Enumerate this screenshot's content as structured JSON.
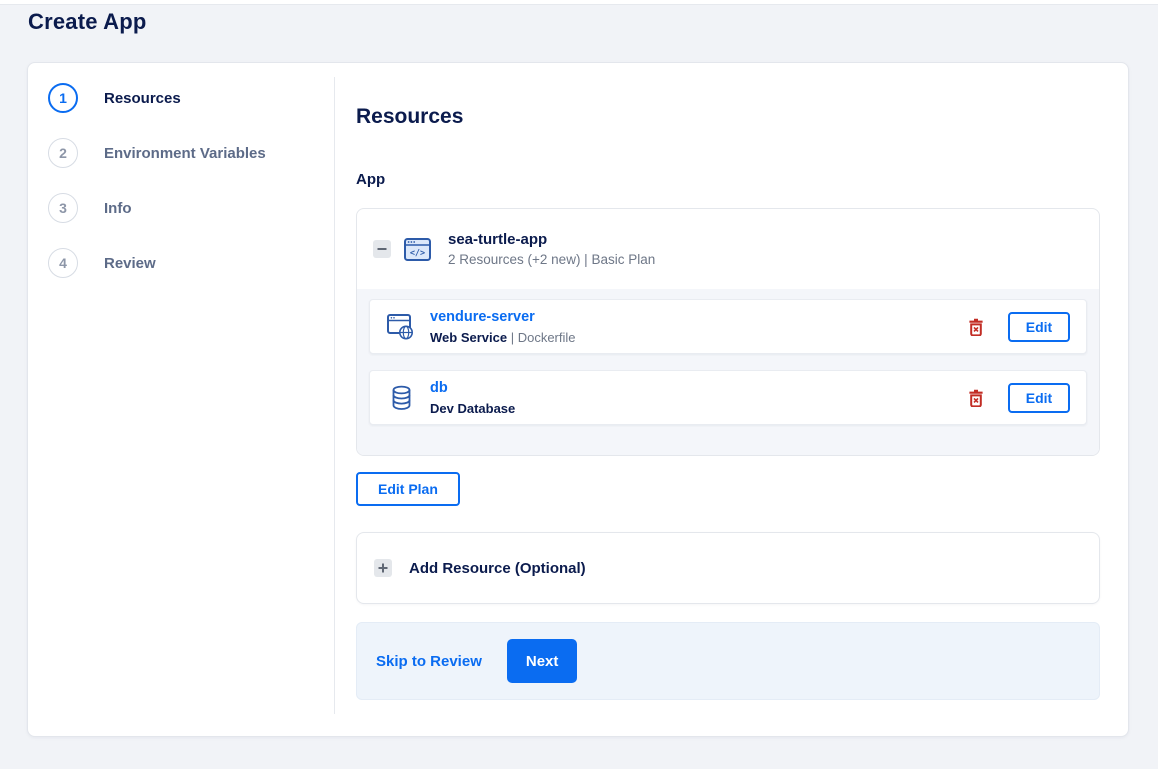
{
  "page_title": "Create App",
  "steps": [
    {
      "number": "1",
      "label": "Resources",
      "active": true
    },
    {
      "number": "2",
      "label": "Environment Variables",
      "active": false
    },
    {
      "number": "3",
      "label": "Info",
      "active": false
    },
    {
      "number": "4",
      "label": "Review",
      "active": false
    }
  ],
  "content": {
    "heading": "Resources",
    "section_label": "App",
    "app_group": {
      "name": "sea-turtle-app",
      "summary": "2 Resources (+2 new) | Basic Plan",
      "collapse_icon": "minus-icon",
      "app_icon": "code-window-icon",
      "resources": [
        {
          "name": "vendure-server",
          "type": "Web Service",
          "sep": " | ",
          "detail": "Dockerfile",
          "icon": "web-service-icon",
          "delete_icon": "trash-icon",
          "edit_label": "Edit"
        },
        {
          "name": "db",
          "type": "Dev Database",
          "sep": "",
          "detail": "",
          "icon": "database-icon",
          "delete_icon": "trash-icon",
          "edit_label": "Edit"
        }
      ]
    },
    "edit_plan_label": "Edit Plan",
    "add_resource": {
      "label": "Add Resource (Optional)",
      "icon": "plus-icon"
    }
  },
  "footer": {
    "skip_label": "Skip to Review",
    "next_label": "Next"
  },
  "colors": {
    "accent": "#0a6cf1",
    "navy": "#0b1b4d",
    "danger": "#c22d25",
    "page_background": "#f1f3f7",
    "group_body_background": "#f4f6fa",
    "footer_background": "#eef4fb"
  }
}
